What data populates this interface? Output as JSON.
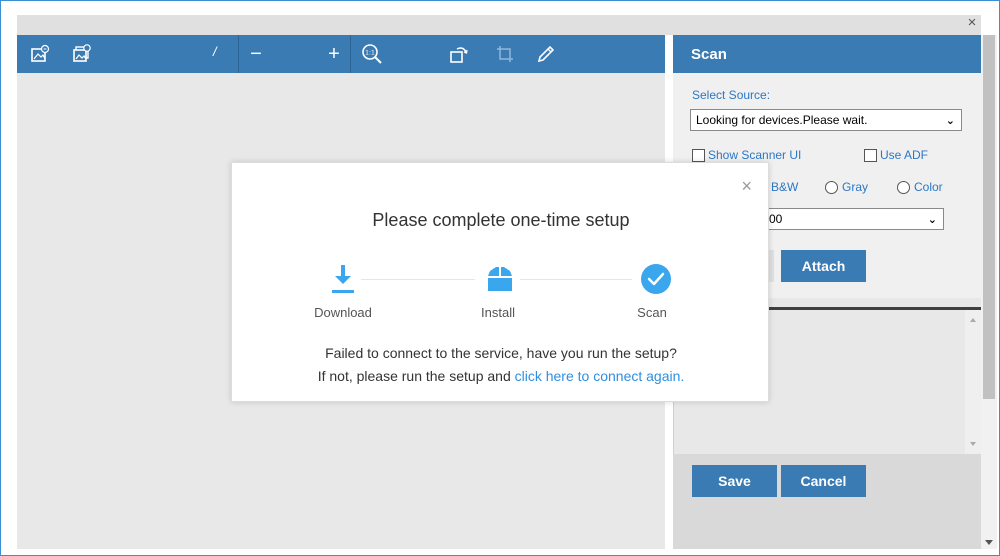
{
  "window": {
    "close_glyph": "×"
  },
  "toolbar": {
    "page_indicator": "/",
    "icons": [
      "image-scan-icon",
      "multi-image-scan-icon",
      "zoom-out-icon",
      "zoom-in-icon",
      "actual-size-icon",
      "rotate-icon",
      "crop-icon",
      "edit-pencil-icon"
    ],
    "zoom_out_glyph": "−",
    "zoom_in_glyph": "+"
  },
  "panel": {
    "title": "Scan",
    "select_source_label": "Select Source:",
    "source_value": "Looking for devices.Please wait.",
    "show_scanner_ui": "Show Scanner UI",
    "use_adf": "Use ADF",
    "color_modes": [
      "B&W",
      "Gray",
      "Color"
    ],
    "resolution_value_partial": "00",
    "attach_label": "Attach",
    "save_label": "Save",
    "cancel_label": "Cancel",
    "caret_glyph": "⌄"
  },
  "modal": {
    "close_glyph": "×",
    "title": "Please complete one-time setup",
    "steps": [
      {
        "label": "Download",
        "icon": "download-icon"
      },
      {
        "label": "Install",
        "icon": "install-box-icon"
      },
      {
        "label": "Scan",
        "icon": "check-circle-icon"
      }
    ],
    "message_line1": "Failed to connect to the service, have you run the setup?",
    "message_line2_prefix": "If not, please run the setup and ",
    "message_link": "click here to connect again.",
    "accent_color": "#3aa6ee"
  },
  "colors": {
    "toolbar_blue": "#3a7bb4",
    "label_blue": "#2b78c5",
    "link_blue": "#2f8fe0"
  }
}
